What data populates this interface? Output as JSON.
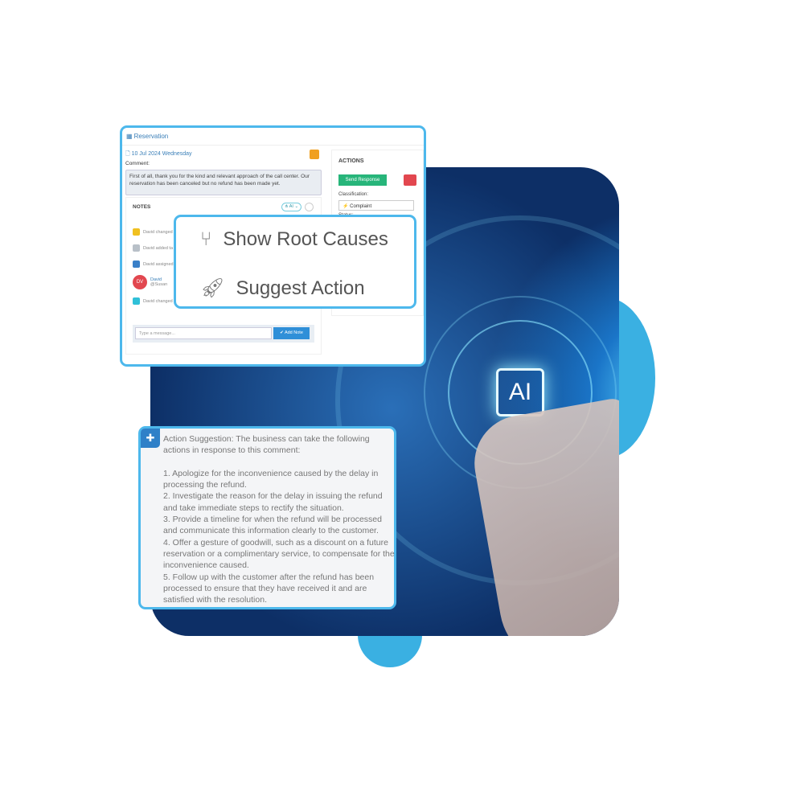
{
  "reservation": {
    "title": "Reservation",
    "date": "10 Jul 2024 Wednesday",
    "comment_label": "Comment:",
    "comment": "First of all, thank you for the kind and relevant approach of the call center. Our reservation has been canceled but no refund has been made yet.",
    "notes": {
      "title": "NOTES",
      "filter": "AI",
      "items": [
        {
          "text": "David changed",
          "color": "#f0c020"
        },
        {
          "text": "David added ta",
          "color": "#b8c0c8"
        },
        {
          "text": "David assigned",
          "color": "#3a80c8"
        },
        {
          "text": "David changed",
          "color": "#30c0d8"
        }
      ],
      "mention": {
        "initials": "DV",
        "name": "David",
        "handle": "@Susan"
      },
      "placeholder": "Type a message...",
      "add_label": "✔ Add Note"
    },
    "actions": {
      "title": "ACTIONS",
      "send_label": "Send Response",
      "classification_label": "Classification:",
      "classification": "⚡ Complaint",
      "status_label": "Status:"
    }
  },
  "menu": {
    "items": [
      {
        "label": "Show Root Causes",
        "icon": "branch-icon"
      },
      {
        "label": "Suggest Action",
        "icon": "rocket-icon"
      }
    ]
  },
  "suggestion": {
    "text": "Action Suggestion: The business can take the following actions in response to this comment:\n\n1. Apologize for the inconvenience caused by the delay in processing the refund.\n2. Investigate the reason for the delay in issuing the refund and take immediate steps to rectify the situation.\n3. Provide a timeline for when the refund will be processed and communicate this information clearly to the customer.\n4. Offer a gesture of goodwill, such as a discount on a future reservation or a complimentary service, to compensate for the inconvenience caused.\n5. Follow up with the customer after the refund has been processed to ensure that they have received it and are satisfied with the resolution."
  },
  "hero": {
    "chip_label": "AI"
  },
  "colors": {
    "accent": "#4db8ec",
    "blob": "#3ab0e2",
    "send": "#27b57a",
    "danger": "#e2474f"
  }
}
